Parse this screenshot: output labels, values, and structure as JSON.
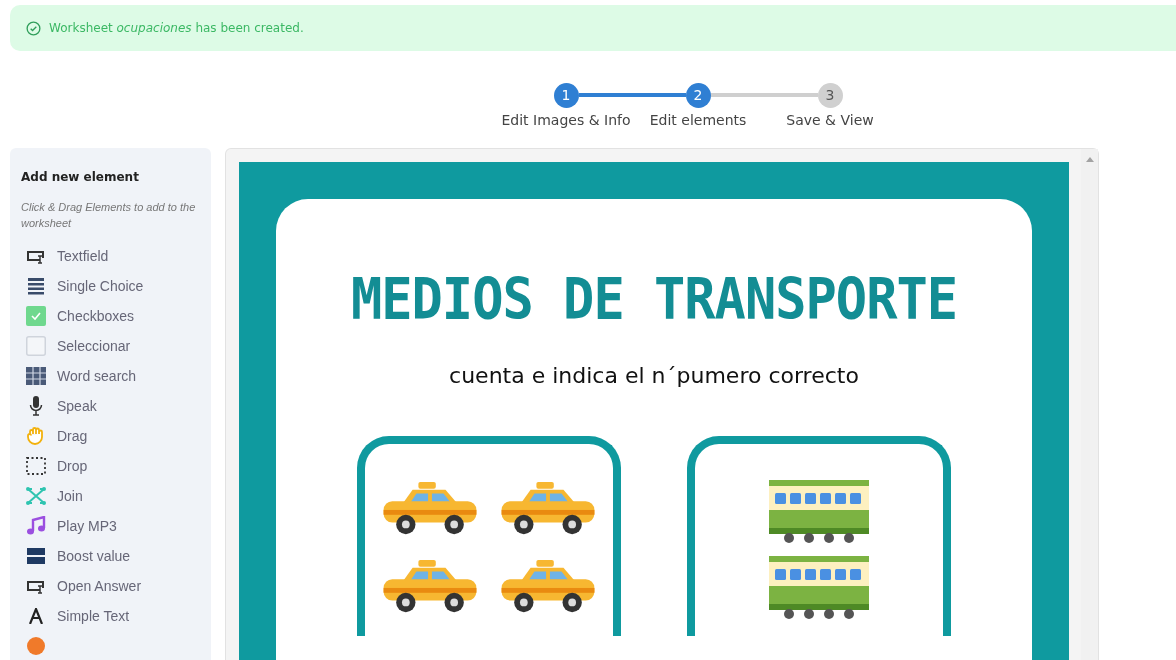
{
  "notice": {
    "text": "Worksheet *ocupaciones* has been created."
  },
  "steps": [
    {
      "number": "1",
      "label": "Edit Images & Info",
      "completed": true
    },
    {
      "number": "2",
      "label": "Edit elements",
      "completed": true
    },
    {
      "number": "3",
      "label": "Save & View",
      "completed": false
    }
  ],
  "sidebar": {
    "title": "Add new element",
    "hint": "Click & Drag Elements to add to the worksheet",
    "items": [
      {
        "kind": "textfield",
        "label": "Textfield"
      },
      {
        "kind": "single-choice",
        "label": "Single Choice"
      },
      {
        "kind": "checkboxes",
        "label": "Checkboxes"
      },
      {
        "kind": "select",
        "label": "Seleccionar"
      },
      {
        "kind": "word-search",
        "label": "Word search"
      },
      {
        "kind": "speak",
        "label": "Speak"
      },
      {
        "kind": "drag",
        "label": "Drag"
      },
      {
        "kind": "drop",
        "label": "Drop"
      },
      {
        "kind": "join",
        "label": "Join"
      },
      {
        "kind": "mp3",
        "label": "Play MP3"
      },
      {
        "kind": "boost",
        "label": "Boost value"
      },
      {
        "kind": "textfield",
        "label": "Open Answer"
      },
      {
        "kind": "text",
        "label": "Simple Text"
      }
    ]
  },
  "worksheet": {
    "title": "MEDIOS DE TRANSPORTE",
    "subtitle": "cuenta e indica el n´pumero correcto",
    "cards": [
      {
        "kind": "grid",
        "pictures": [
          {
            "kind": "taxi"
          },
          {
            "kind": "taxi"
          },
          {
            "kind": "taxi"
          },
          {
            "kind": "taxi"
          }
        ]
      },
      {
        "kind": "column",
        "pictures": [
          {
            "kind": "train"
          },
          {
            "kind": "train"
          }
        ]
      }
    ]
  }
}
